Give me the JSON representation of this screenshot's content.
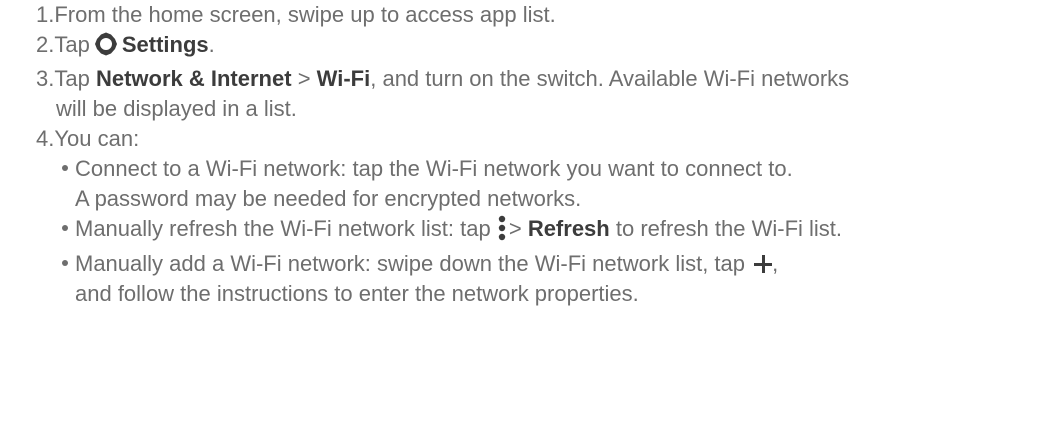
{
  "steps": [
    {
      "num": "1.",
      "text": "From the home screen, swipe up to access app list."
    },
    {
      "num": "2.",
      "pre": "Tap",
      "bold": "Settings",
      "post": ".",
      "icon": "gear-icon"
    },
    {
      "num": "3.",
      "pre": "Tap",
      "bold1": "Network & Internet",
      "sep": ">",
      "bold2": "Wi-Fi",
      "post_line1": ", and turn on the switch. Available Wi-Fi networks",
      "line2": "will be displayed in a list."
    },
    {
      "num": "4.",
      "text": "You can:"
    }
  ],
  "bullets": [
    {
      "line1": "Connect to a Wi-Fi network: tap the Wi-Fi network you want to connect to.",
      "line2": "A password may be needed for encrypted networks."
    },
    {
      "pre": "Manually refresh the Wi-Fi network list: tap",
      "icon": "more-vertical-icon",
      "sep": ">",
      "bold": "Refresh",
      "post": "to refresh the Wi-Fi list."
    },
    {
      "pre": "Manually add a Wi-Fi network: swipe down the Wi-Fi network list, tap",
      "icon": "plus-icon",
      "post": ",",
      "line2": "and follow the instructions to enter the network properties."
    }
  ],
  "colors": {
    "body_text": "#6e6e6e",
    "emphasis_text": "#3c3c3c"
  }
}
